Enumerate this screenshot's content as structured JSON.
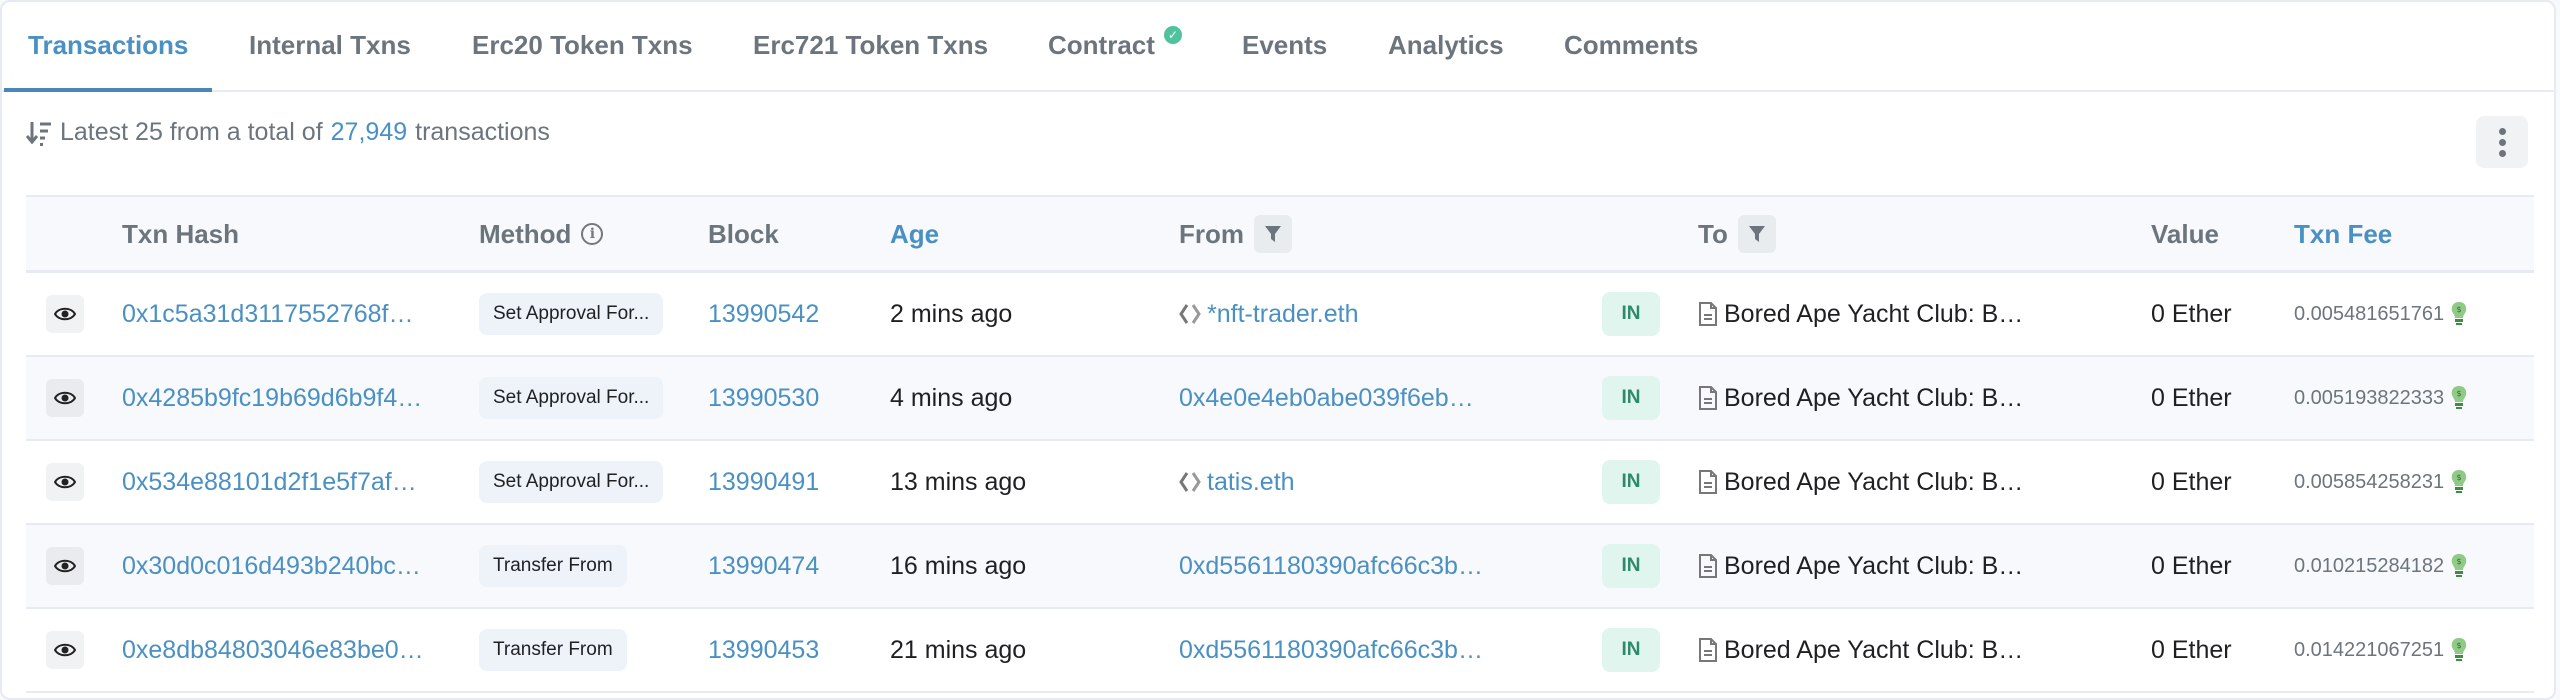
{
  "tabs": [
    {
      "label": "Transactions",
      "active": true
    },
    {
      "label": "Internal Txns"
    },
    {
      "label": "Erc20 Token Txns"
    },
    {
      "label": "Erc721 Token Txns"
    },
    {
      "label": "Contract",
      "verified": true
    },
    {
      "label": "Events"
    },
    {
      "label": "Analytics"
    },
    {
      "label": "Comments"
    }
  ],
  "summary": {
    "prefix": "Latest 25 from a total of",
    "total": "27,949",
    "suffix": "transactions"
  },
  "columns": {
    "txn_hash": "Txn Hash",
    "method": "Method",
    "block": "Block",
    "age": "Age",
    "from": "From",
    "to": "To",
    "value": "Value",
    "txn_fee": "Txn Fee"
  },
  "rows": [
    {
      "hash": "0x1c5a31d3117552768f…",
      "method": "Set Approval For...",
      "block": "13990542",
      "age": "2 mins ago",
      "from": "*nft-trader.eth",
      "from_ens": true,
      "direction": "IN",
      "to": "Bored Ape Yacht Club: B…",
      "value": "0 Ether",
      "fee": "0.005481651761"
    },
    {
      "hash": "0x4285b9fc19b69d6b9f4…",
      "method": "Set Approval For...",
      "block": "13990530",
      "age": "4 mins ago",
      "from": "0x4e0e4eb0abe039f6eb…",
      "from_ens": false,
      "direction": "IN",
      "to": "Bored Ape Yacht Club: B…",
      "value": "0 Ether",
      "fee": "0.005193822333"
    },
    {
      "hash": "0x534e88101d2f1e5f7af…",
      "method": "Set Approval For...",
      "block": "13990491",
      "age": "13 mins ago",
      "from": "tatis.eth",
      "from_ens": true,
      "direction": "IN",
      "to": "Bored Ape Yacht Club: B…",
      "value": "0 Ether",
      "fee": "0.005854258231"
    },
    {
      "hash": "0x30d0c016d493b240bc…",
      "method": "Transfer From",
      "block": "13990474",
      "age": "16 mins ago",
      "from": "0xd5561180390afc66c3b…",
      "from_ens": false,
      "direction": "IN",
      "to": "Bored Ape Yacht Club: B…",
      "value": "0 Ether",
      "fee": "0.010215284182"
    },
    {
      "hash": "0xe8db84803046e83be0…",
      "method": "Transfer From",
      "block": "13990453",
      "age": "21 mins ago",
      "from": "0xd5561180390afc66c3b…",
      "from_ens": false,
      "direction": "IN",
      "to": "Bored Ape Yacht Club: B…",
      "value": "0 Ether",
      "fee": "0.014221067251"
    }
  ],
  "colors": {
    "accent": "#4a90c2",
    "in_badge_bg": "#dff5ee",
    "in_badge_text": "#2f8a6a",
    "verified": "#4fc39a",
    "gas_icon": "#7cc07a"
  }
}
